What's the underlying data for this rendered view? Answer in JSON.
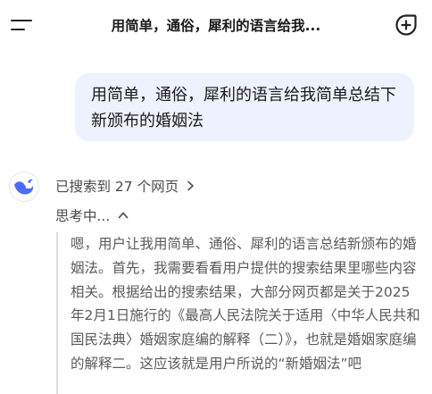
{
  "header": {
    "title": "用简单，通俗，犀利的语言给我...",
    "menu_icon": "menu-icon",
    "new_chat_icon": "plus-circle-icon"
  },
  "user_message": {
    "text": "用简单，通俗，犀利的语言给我简单总结下新颁布的婚姻法"
  },
  "assistant": {
    "logo_icon": "whale-logo-icon",
    "search_status": "已搜索到 27 个网页",
    "thinking_label": "思考中...",
    "thinking_text": "嗯，用户让我用简单、通俗、犀利的语言总结新颁布的婚姻法。首先，我需要看看用户提供的搜索结果里哪些内容相关。根据给出的搜索结果，大部分网页都是关于2025年2月1日施行的《最高人民法院关于适用〈中华人民共和国民法典〉婚姻家庭编的解释（二）》，也就是婚姻家庭编的解释二。这应该就是用户所说的“新婚姻法”吧"
  },
  "colors": {
    "bubble_bg": "#eef2ff",
    "brand_blue": "#4d6bfe",
    "thinking_border": "#dadde2"
  }
}
